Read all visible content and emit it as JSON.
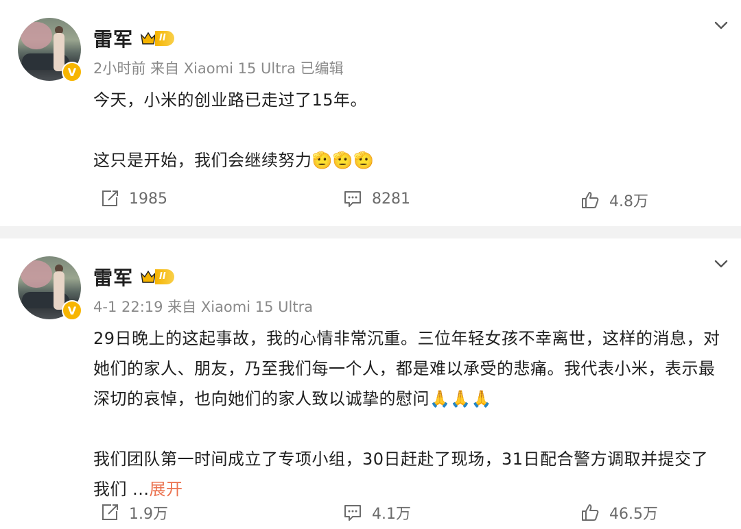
{
  "posts": [
    {
      "author": "雷军",
      "vip_level": "II",
      "meta": "2小时前 来自 Xiaomi 15 Ultra 已编辑",
      "paragraphs": [
        "今天，小米的创业路已走过了15年。",
        "这只是开始，我们会继续努力🫡🫡🫡"
      ],
      "expand_label": "",
      "reposts": "1985",
      "comments": "8281",
      "likes": "4.8万"
    },
    {
      "author": "雷军",
      "vip_level": "II",
      "meta": "4-1 22:19 来自 Xiaomi 15 Ultra",
      "paragraphs": [
        "29日晚上的这起事故，我的心情非常沉重。三位年轻女孩不幸离世，这样的消息，对她们的家人、朋友，乃至我们每一个人，都是难以承受的悲痛。我代表小米，表示最深切的哀悼，也向她们的家人致以诚挚的慰问🙏🙏🙏",
        "我们团队第一时间成立了专项小组，30日赶赴了现场，31日配合警方调取并提交了我们 ..."
      ],
      "expand_label": "展开",
      "reposts": "1.9万",
      "comments": "4.1万",
      "likes": "46.5万"
    }
  ],
  "colors": {
    "accent": "#eb7350",
    "badge": "#f7b500",
    "meta": "#8a8a8a",
    "divider": "#f2f2f2"
  },
  "icons": {
    "verified": "V",
    "repost": "repost-icon",
    "comment": "comment-icon",
    "like": "like-icon",
    "menu": "chevron-down-icon"
  }
}
